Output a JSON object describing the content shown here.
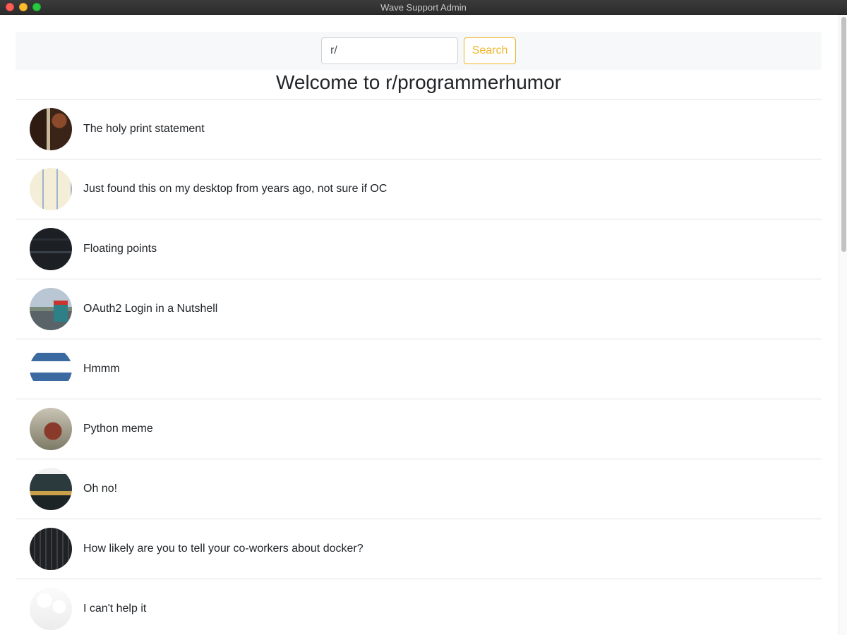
{
  "window": {
    "title": "Wave Support Admin"
  },
  "search": {
    "value": "r/",
    "button_label": "Search"
  },
  "page": {
    "title": "Welcome to r/programmerhumor"
  },
  "posts": [
    {
      "title": "The holy print statement"
    },
    {
      "title": "Just found this on my desktop from years ago, not sure if OC"
    },
    {
      "title": "Floating points"
    },
    {
      "title": "OAuth2 Login in a Nutshell"
    },
    {
      "title": "Hmmm"
    },
    {
      "title": "Python meme"
    },
    {
      "title": "Oh no!"
    },
    {
      "title": "How likely are you to tell your co-workers about docker?"
    },
    {
      "title": "I can't help it"
    }
  ],
  "colors": {
    "accent": "#f0b429",
    "search_bar_bg": "#f7f8f9",
    "divider": "#dfe2e5"
  }
}
